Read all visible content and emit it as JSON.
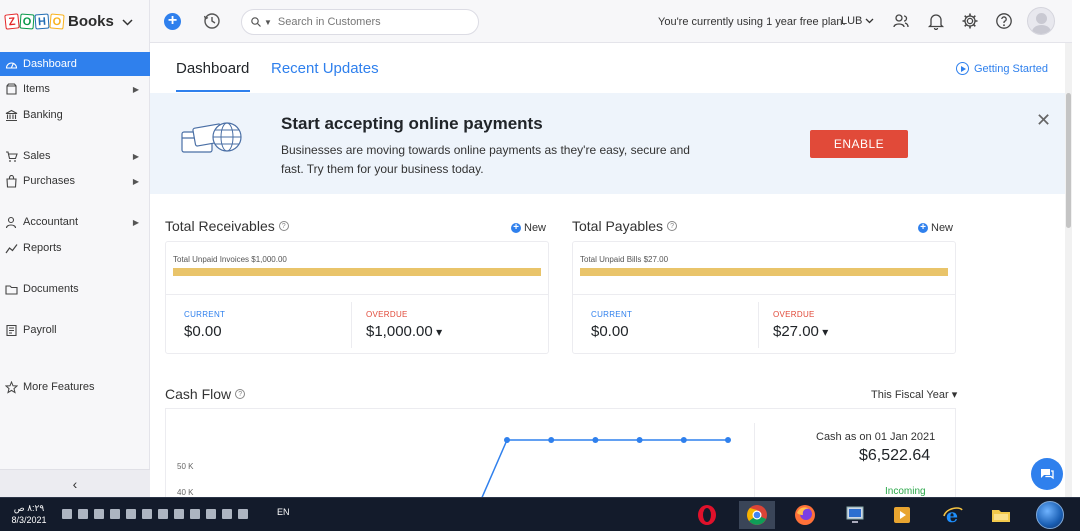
{
  "app": {
    "brand_letters": [
      "Z",
      "O",
      "H",
      "O"
    ],
    "product": "Books"
  },
  "topbar": {
    "search_placeholder": "Search in Customers",
    "plan_text": "You're currently using 1 year free plan.",
    "org_name": "LUB"
  },
  "sidebar": {
    "items": [
      {
        "label": "Dashboard",
        "icon": "dashboard-icon",
        "active": true,
        "has_arrow": false
      },
      {
        "label": "Items",
        "icon": "items-icon",
        "active": false,
        "has_arrow": true
      },
      {
        "label": "Banking",
        "icon": "bank-icon",
        "active": false,
        "has_arrow": false
      },
      {
        "label": "Sales",
        "icon": "cart-icon",
        "active": false,
        "has_arrow": true
      },
      {
        "label": "Purchases",
        "icon": "bag-icon",
        "active": false,
        "has_arrow": true
      },
      {
        "label": "Accountant",
        "icon": "person-icon",
        "active": false,
        "has_arrow": true
      },
      {
        "label": "Reports",
        "icon": "chart-line-icon",
        "active": false,
        "has_arrow": false
      },
      {
        "label": "Documents",
        "icon": "folder-icon",
        "active": false,
        "has_arrow": false
      },
      {
        "label": "Payroll",
        "icon": "payroll-icon",
        "active": false,
        "has_arrow": false
      },
      {
        "label": "More Features",
        "icon": "star-icon",
        "active": false,
        "has_arrow": false
      }
    ],
    "collapse_glyph": "‹"
  },
  "tabs": {
    "dashboard": "Dashboard",
    "recent_updates": "Recent Updates",
    "getting_started": "Getting Started"
  },
  "banner": {
    "title": "Start accepting online payments",
    "description": "Businesses are moving towards online payments as they're easy, secure and fast. Try them for your business today.",
    "button": "ENABLE",
    "close": "✕"
  },
  "receivables": {
    "title": "Total Receivables",
    "new_label": "New",
    "unpaid": "Total Unpaid Invoices $1,000.00",
    "current_label": "CURRENT",
    "current_amount": "$0.00",
    "overdue_label": "OVERDUE",
    "overdue_amount": "$1,000.00"
  },
  "payables": {
    "title": "Total Payables",
    "new_label": "New",
    "unpaid": "Total Unpaid Bills $27.00",
    "current_label": "CURRENT",
    "current_amount": "$0.00",
    "overdue_label": "OVERDUE",
    "overdue_amount": "$27.00"
  },
  "cashflow": {
    "title": "Cash Flow",
    "period": "This Fiscal Year",
    "cash_label": "Cash as on 01 Jan 2021",
    "cash_amount": "$6,522.64",
    "incoming_label": "Incoming",
    "y_ticks": [
      "50 K",
      "40 K"
    ]
  },
  "chart_data": {
    "type": "line",
    "y_ticks": [
      50000,
      40000
    ],
    "series": [
      {
        "values": [
          60000,
          60000,
          60000,
          60000,
          60000,
          60000
        ]
      }
    ]
  },
  "taskbar": {
    "time": "٨:٢٩ ص",
    "date": "8/3/2021",
    "language": "EN"
  },
  "colors": {
    "accent": "#2f80ed",
    "enable_button": "#e14a39",
    "bar_fill": "#e9c46a",
    "incoming": "#2ba84a"
  }
}
